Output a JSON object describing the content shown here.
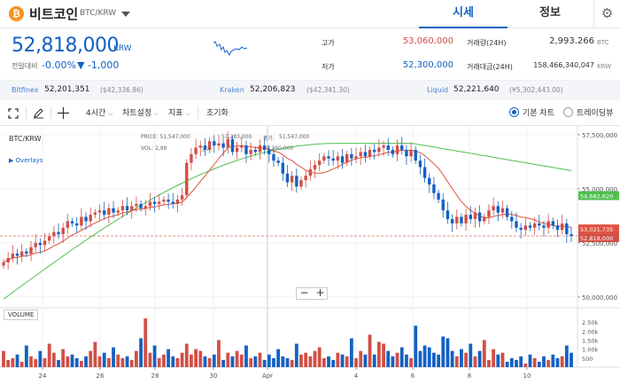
{
  "header": {
    "coin_logo": "₿",
    "coin_name": "비트코인",
    "coin_pair": "BTC/KRW",
    "tab_market": "시세",
    "tab_info": "정보",
    "gear_icon": "gear-icon"
  },
  "summary": {
    "price": "52,818,000",
    "unit": "KRW",
    "prev_label": "전일대비",
    "change_rate": "-0.00%",
    "change_amount": "▼ -1,000",
    "high_label": "고가",
    "high_value": "53,060,000",
    "low_label": "저가",
    "low_value": "52,300,000",
    "volume_label": "거래량(24H)",
    "volume_value": "2,993.266",
    "volume_unit": "BTC",
    "amount_label": "거래대금(24H)",
    "amount_value": "158,466,340,047",
    "amount_unit": "KRW"
  },
  "exchanges": [
    {
      "name": "Bitfinex",
      "price": "52,201,351",
      "sub": "($42,336.86)"
    },
    {
      "name": "Kraken",
      "price": "52,206,823",
      "sub": "($42,341.30)"
    },
    {
      "name": "Liquid",
      "price": "52,221,640",
      "sub": "(¥5,302,443.00)"
    }
  ],
  "toolbar": {
    "interval": "4시간",
    "chart_settings": "차트설정",
    "indicators": "지표",
    "reset": "초기화",
    "basic_chart": "기본 차트",
    "tradingview": "트레이딩뷰"
  },
  "chart": {
    "symbol": "BTC/KRW",
    "overlays": "Overlays",
    "legend_price": "PRICE: 51,547,000",
    "legend_high": "51,283,000",
    "legend_close_label": "종가:",
    "legend_close": "51,547,000",
    "legend_vol": "VOL: 2,99",
    "legend_low_label": "고가:",
    "legend_low": "51,260,000",
    "volume_label": "VOLUME",
    "zoom_out": "−",
    "zoom_in": "+",
    "colors": {
      "up": "#d24f45",
      "down": "#1261c4",
      "ma_short": "#e0533f",
      "ma_long": "#4fbf4f"
    }
  },
  "chart_data": {
    "type": "candlestick",
    "title": "BTC/KRW",
    "x_ticks": [
      "24",
      "26",
      "28",
      "30",
      "Apr",
      "4",
      "6",
      "8",
      "10"
    ],
    "y_ticks": [
      "57,500,000",
      "55,000,000",
      "52,500,000",
      "50,000,000"
    ],
    "y_labels": [
      "54,682,620",
      "53,021,735",
      "52,818,000"
    ],
    "vol_ticks": [
      "2.50k",
      "2.00k",
      "1.50k",
      "1.00k",
      "500"
    ],
    "ylim": [
      49500000,
      57700000
    ],
    "closes": [
      51600000,
      51800000,
      52000000,
      51900000,
      52100000,
      52000000,
      52300000,
      52500000,
      52400000,
      52600000,
      52800000,
      53000000,
      52900000,
      53200000,
      53500000,
      53400000,
      53300000,
      53700000,
      53500000,
      53800000,
      53900000,
      54000000,
      53800000,
      54100000,
      53900000,
      54000000,
      54200000,
      54000000,
      54200000,
      54300000,
      54100000,
      54200000,
      54400000,
      54300000,
      54400000,
      54500000,
      54400000,
      54300000,
      54500000,
      54700000,
      56200000,
      56600000,
      56900000,
      57000000,
      56800000,
      57200000,
      57000000,
      57100000,
      56900000,
      57300000,
      56700000,
      56900000,
      57000000,
      56600000,
      56800000,
      56700000,
      57000000,
      56800000,
      56600000,
      56300000,
      56200000,
      55700000,
      55300000,
      55600000,
      55100000,
      55400000,
      55600000,
      55900000,
      56100000,
      56300000,
      56500000,
      56400000,
      56300000,
      56500000,
      56200000,
      56600000,
      56400000,
      56500000,
      56700000,
      56500000,
      56800000,
      56700000,
      56900000,
      57000000,
      56800000,
      56600000,
      57000000,
      56800000,
      56500000,
      56800000,
      56300000,
      56000000,
      55500000,
      55200000,
      54800000,
      54500000,
      54000000,
      53600000,
      53400000,
      53700000,
      53400000,
      53800000,
      53600000,
      53900000,
      53500000,
      53700000,
      54000000,
      54200000,
      53900000,
      54100000,
      53700000,
      53500000,
      53200000,
      53100000,
      53300000,
      53200000,
      53400000,
      53300000,
      53200000,
      53500000,
      53300000,
      53100000,
      53400000,
      52900000,
      52818000
    ],
    "volumes": [
      900,
      400,
      500,
      700,
      300,
      1200,
      600,
      450,
      900,
      500,
      1300,
      800,
      400,
      1000,
      600,
      700,
      500,
      350,
      600,
      900,
      1400,
      600,
      800,
      500,
      1100,
      700,
      500,
      600,
      400,
      900,
      1600,
      2700,
      800,
      1200,
      500,
      700,
      1000,
      600,
      500,
      800,
      1300,
      700,
      1000,
      900,
      600,
      500,
      700,
      1500,
      400,
      800,
      600,
      900,
      700,
      1200,
      500,
      600,
      800,
      400,
      700,
      500,
      1000,
      600,
      500,
      400,
      1300,
      700,
      800,
      600,
      900,
      1100,
      500,
      600,
      400,
      800,
      700,
      600,
      1600,
      500,
      900,
      700,
      1800,
      700,
      1400,
      1300,
      900,
      600,
      800,
      1100,
      700,
      500,
      2300,
      900,
      1200,
      1100,
      800,
      700,
      1700,
      1600,
      900,
      600,
      1000,
      800,
      1300,
      600,
      900,
      1500,
      400,
      1000,
      700,
      800,
      300,
      500,
      400,
      600,
      200,
      700,
      500,
      300,
      600,
      400,
      700,
      500,
      600,
      1200,
      800
    ]
  }
}
